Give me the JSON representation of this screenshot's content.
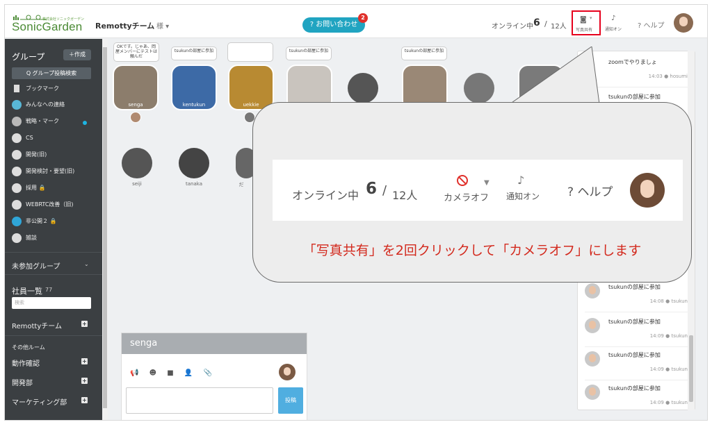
{
  "header": {
    "logo_sub": "株式会社ソニックガーデン",
    "logo": "SonicGarden",
    "team_name": "Remottyチーム",
    "team_menu": "様 ▾",
    "contact_label": "? お問い合わせ",
    "contact_badge": "2",
    "online_label": "オンライン中",
    "online_count": "6",
    "online_slash": "/",
    "online_total": "12人",
    "photo_share_label": "写真共有",
    "notify_label": "通知オン",
    "help_label": "? ヘルプ"
  },
  "sidebar": {
    "group_title": "グループ",
    "create_label": "＋作成",
    "search_label": "Q グループ投稿検索",
    "items": [
      {
        "label": "ブックマーク"
      },
      {
        "label": "みんなへの連絡"
      },
      {
        "label": "戦略・マーク"
      },
      {
        "label": "CS"
      },
      {
        "label": "開発(旧)"
      },
      {
        "label": "開発検討・要望(旧)"
      },
      {
        "label": "採用 🔒"
      },
      {
        "label": "WEBRTC改善（旧)"
      },
      {
        "label": "非公開２ 🔒"
      },
      {
        "label": "雑談"
      }
    ],
    "unjoined_label": "未参加グループ",
    "members_label": "社員一覧",
    "members_count": "77",
    "member_search_placeholder": "検索",
    "team_room": "Remottyチーム",
    "other_rooms_label": "その他ルーム",
    "rooms": [
      {
        "label": "動作確認"
      },
      {
        "label": "開発部"
      },
      {
        "label": "マーケティング部"
      }
    ]
  },
  "stage": {
    "bubbles": [
      {
        "text": "OKです。じゃあ、岡屋メンバーにテストは頼んだ"
      },
      {
        "text": "tsukunの部屋に参加"
      },
      {
        "text": ""
      },
      {
        "text": "tsukunの部屋に参加"
      },
      {
        "text": "tsukunの部屋に参加"
      }
    ],
    "tiles": [
      {
        "name": "senga"
      },
      {
        "name": "kentukun"
      },
      {
        "name": "uekkie"
      }
    ],
    "users": [
      {
        "name": "seiji"
      },
      {
        "name": "tanaka"
      },
      {
        "name": "だ"
      }
    ]
  },
  "chat": {
    "messages": [
      {
        "text": "zoomでやりましょ",
        "time": "14:03",
        "user": "hosumi"
      },
      {
        "text": "tsukunの部屋に参加",
        "time": "",
        "user": ""
      },
      {
        "text": "tsukunの部屋に参加",
        "time": "14:08",
        "user": "tsukun"
      },
      {
        "text": "tsukunの部屋に参加",
        "time": "14:09",
        "user": "tsukun"
      },
      {
        "text": "tsukunの部屋に参加",
        "time": "14:09",
        "user": "tsukun"
      },
      {
        "text": "tsukunの部屋に参加",
        "time": "14:09",
        "user": "tsukun"
      }
    ]
  },
  "compose": {
    "title": "senga",
    "tools": "📢 ☻ ■ 👤 📎",
    "post_label": "投稿"
  },
  "callout": {
    "online_label": "オンライン中",
    "online_count": "6",
    "online_slash": "/",
    "online_total": "12人",
    "camera_label": "カメラオフ",
    "notify_label": "通知オン",
    "help_label": "ヘルプ",
    "instruction": "「写真共有」を2回クリックして「カメラオフ」にします"
  },
  "colors": {
    "brand_green": "#4a8a34",
    "accent_blue": "#20a4c1",
    "highlight_red": "#e6001c",
    "instruction_red": "#d32a1e",
    "sidebar_bg": "#3b3f42"
  }
}
